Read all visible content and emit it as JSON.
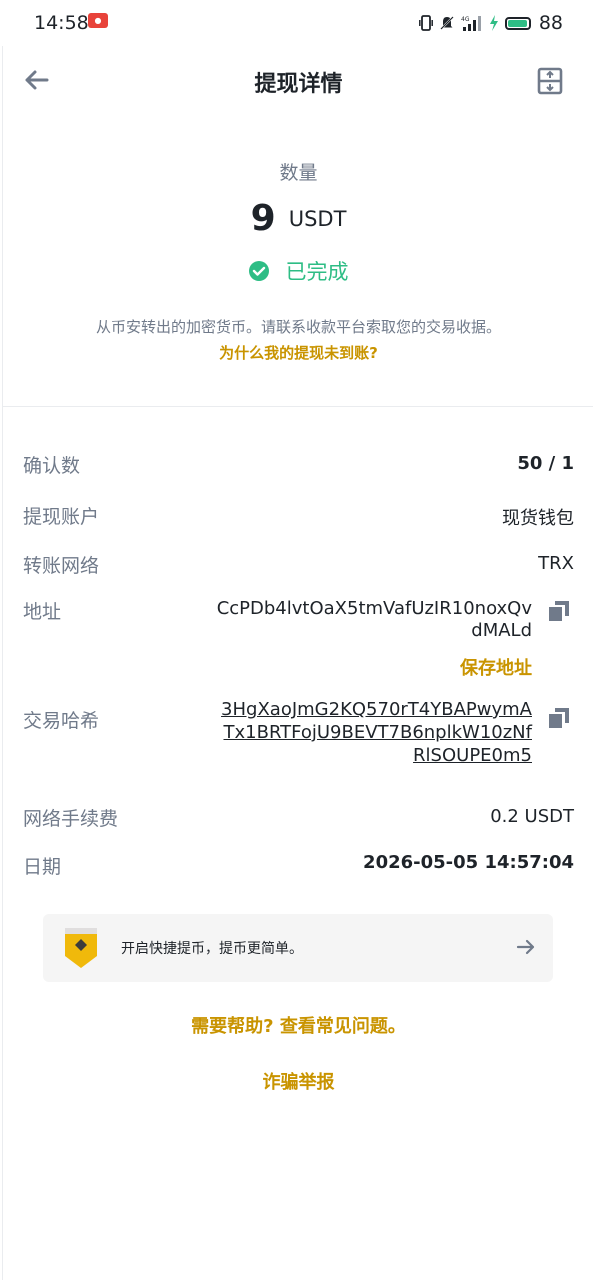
{
  "status_bar": {
    "time": "14:58",
    "battery": "88",
    "network": "4G"
  },
  "nav": {
    "title": "提现详情"
  },
  "summary": {
    "amount_label": "数量",
    "amount": "9",
    "unit": "USDT",
    "status": "已完成",
    "info": "从币安转出的加密货币。请联系收款平台索取您的交易收据。",
    "why_link": "为什么我的提现未到账?"
  },
  "details": {
    "confirmations": {
      "label": "确认数",
      "value": "50 / 1"
    },
    "account": {
      "label": "提现账户",
      "value": "现货钱包"
    },
    "network": {
      "label": "转账网络",
      "value": "TRX"
    },
    "address": {
      "label": "地址",
      "value": "CcPDb4lvtOaX5tmVafUzIR10noxQvdMALd",
      "save_label": "保存地址"
    },
    "txid": {
      "label": "交易哈希",
      "value": "3HgXaoJmG2KQ570rT4YBAPwymATx1BRTFojU9BEVT7B6nplkW10zNfRlSOUPE0m5"
    },
    "fee": {
      "label": "网络手续费",
      "value": "0.2 USDT"
    },
    "date": {
      "label": "日期",
      "value": "2026-05-05 14:57:04"
    }
  },
  "promo": {
    "text": "开启快捷提币，提币更简单。"
  },
  "links": {
    "help": "需要帮助? 查看常见问题。",
    "fraud": "诈骗举报"
  },
  "colors": {
    "accent": "#c99400",
    "success": "#2ebd85",
    "text_primary": "#1e2329",
    "text_secondary": "#707a8a"
  }
}
